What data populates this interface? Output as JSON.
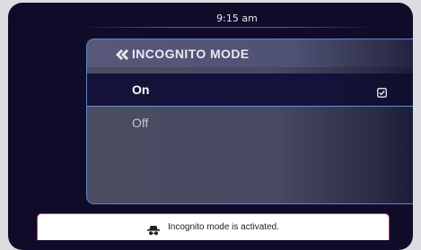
{
  "status_bar": {
    "time": "9:15 am"
  },
  "menu": {
    "title": "INCOGNITO MODE",
    "back_icon": "double-chevron-left-icon",
    "options": [
      {
        "label": "On",
        "selected": true,
        "indicator_icon": "checkbox-checked-icon"
      },
      {
        "label": "Off",
        "selected": false
      }
    ]
  },
  "toast": {
    "icon": "incognito-spy-icon",
    "message": "Incognito mode is activated."
  },
  "colors": {
    "screen_bg": "#110b2a",
    "panel_border": "#5d86c8",
    "selected_row_bg": "#15123a",
    "toast_border": "#d23a56"
  }
}
